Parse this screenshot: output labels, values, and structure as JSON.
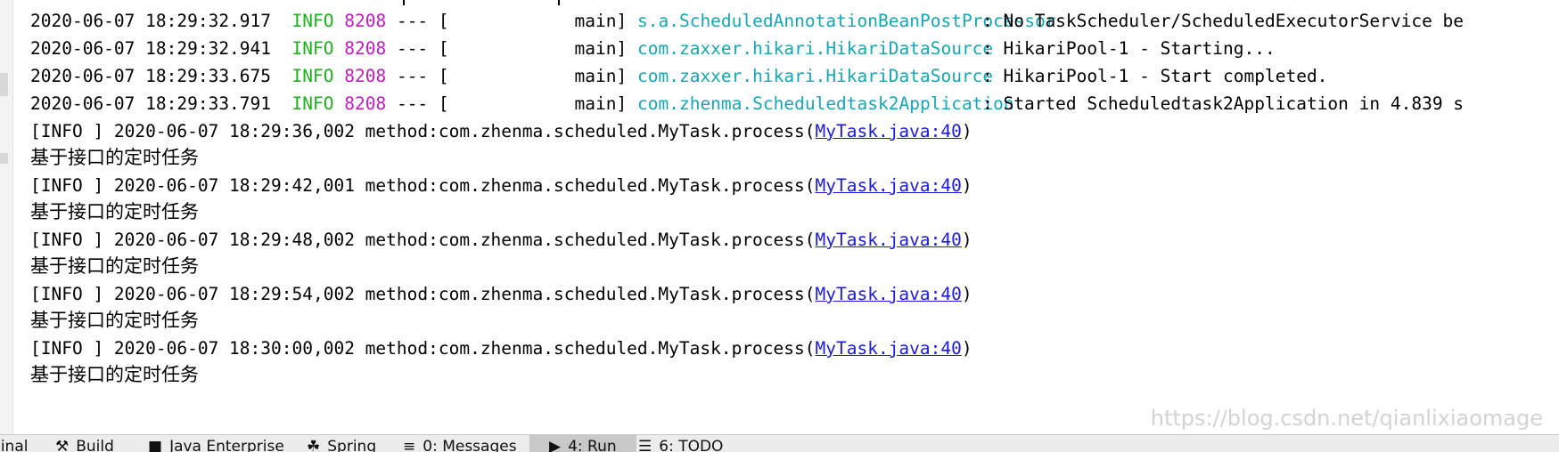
{
  "console": {
    "startup_lines": [
      {
        "timestamp": "2020-06-07 18:29:32.917",
        "level": "INFO",
        "pid": "8208",
        "sep": "--- [",
        "thread": "main]",
        "logger": "s.a.ScheduledAnnotationBeanPostProcessor",
        "message": ": No TaskScheduler/ScheduledExecutorService be"
      },
      {
        "timestamp": "2020-06-07 18:29:32.941",
        "level": "INFO",
        "pid": "8208",
        "sep": "--- [",
        "thread": "main]",
        "logger": "com.zaxxer.hikari.HikariDataSource",
        "message": ": HikariPool-1 - Starting..."
      },
      {
        "timestamp": "2020-06-07 18:29:33.675",
        "level": "INFO",
        "pid": "8208",
        "sep": "--- [",
        "thread": "main]",
        "logger": "com.zaxxer.hikari.HikariDataSource",
        "message": ": HikariPool-1 - Start completed."
      },
      {
        "timestamp": "2020-06-07 18:29:33.791",
        "level": "INFO",
        "pid": "8208",
        "sep": "--- [",
        "thread": "main]",
        "logger": "com.zhenma.Scheduledtask2Application",
        "message": ": Started Scheduledtask2Application in 4.839 s"
      }
    ],
    "task_entries": [
      {
        "prefix": "[INFO ] 2020-06-07 18:29:36,002 method:com.zhenma.scheduled.MyTask.process(",
        "link": "MyTask.java:40",
        "suffix": ")",
        "output": "基于接口的定时任务"
      },
      {
        "prefix": "[INFO ] 2020-06-07 18:29:42,001 method:com.zhenma.scheduled.MyTask.process(",
        "link": "MyTask.java:40",
        "suffix": ")",
        "output": "基于接口的定时任务"
      },
      {
        "prefix": "[INFO ] 2020-06-07 18:29:48,002 method:com.zhenma.scheduled.MyTask.process(",
        "link": "MyTask.java:40",
        "suffix": ")",
        "output": "基于接口的定时任务"
      },
      {
        "prefix": "[INFO ] 2020-06-07 18:29:54,002 method:com.zhenma.scheduled.MyTask.process(",
        "link": "MyTask.java:40",
        "suffix": ")",
        "output": "基于接口的定时任务"
      },
      {
        "prefix": "[INFO ] 2020-06-07 18:30:00,002 method:com.zhenma.scheduled.MyTask.process(",
        "link": "MyTask.java:40",
        "suffix": ")",
        "output": "基于接口的定时任务"
      }
    ]
  },
  "watermark": "https://blog.csdn.net/qianlixiaomage",
  "tool_strip": [
    {
      "label": "ninal",
      "icon": "terminal-icon"
    },
    {
      "label": "Build",
      "icon": "hammer-icon"
    },
    {
      "label": "Java Enterprise",
      "icon": "enterprise-icon"
    },
    {
      "label": "Spring",
      "icon": "spring-leaf-icon"
    },
    {
      "label": "0: Messages",
      "icon": "messages-icon"
    },
    {
      "label": "4: Run",
      "icon": "run-icon",
      "active": true
    },
    {
      "label": "6: TODO",
      "icon": "todo-list-icon"
    }
  ],
  "colors": {
    "info_level": "#19b319",
    "pid": "#c31ac3",
    "logger": "#13a8b8",
    "source_link": "#1a1ae6",
    "text": "#000000"
  }
}
